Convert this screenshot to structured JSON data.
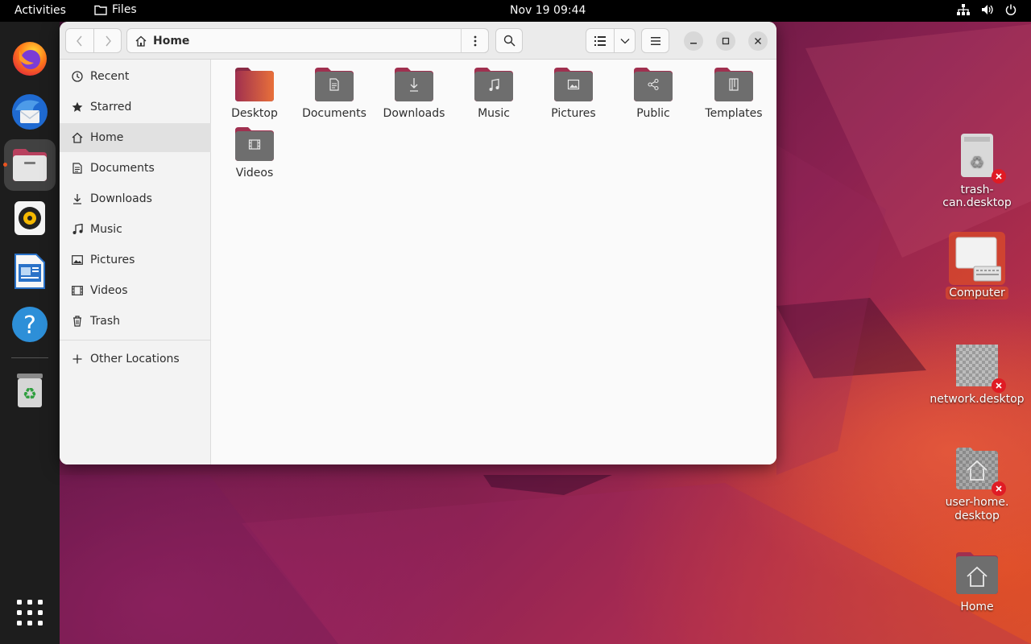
{
  "topbar": {
    "activities": "Activities",
    "app_name": "Files",
    "clock": "Nov 19  09:44"
  },
  "dock": {
    "apps": [
      "firefox",
      "thunderbird",
      "files",
      "rhythmbox",
      "libreoffice-writer",
      "help",
      "trash"
    ]
  },
  "window": {
    "path": "Home",
    "sidebar": [
      {
        "label": "Recent",
        "icon": "clock-icon"
      },
      {
        "label": "Starred",
        "icon": "star-icon"
      },
      {
        "label": "Home",
        "icon": "home-icon"
      },
      {
        "label": "Documents",
        "icon": "document-icon"
      },
      {
        "label": "Downloads",
        "icon": "download-icon"
      },
      {
        "label": "Music",
        "icon": "music-icon"
      },
      {
        "label": "Pictures",
        "icon": "picture-icon"
      },
      {
        "label": "Videos",
        "icon": "video-icon"
      },
      {
        "label": "Trash",
        "icon": "trash-icon"
      }
    ],
    "other_locations": "Other Locations",
    "folders": [
      {
        "label": "Desktop"
      },
      {
        "label": "Documents"
      },
      {
        "label": "Downloads"
      },
      {
        "label": "Music"
      },
      {
        "label": "Pictures"
      },
      {
        "label": "Public"
      },
      {
        "label": "Templates"
      },
      {
        "label": "Videos"
      }
    ]
  },
  "desktop": {
    "icons": [
      {
        "label": "trash-can.desktop"
      },
      {
        "label": "Computer"
      },
      {
        "label": "network.desktop"
      },
      {
        "label": "user-home.\ndesktop"
      },
      {
        "label": "Home"
      }
    ]
  },
  "colors": {
    "accent": "#e95420",
    "folder": "#6e6e6e",
    "folder_tab": "#a0304f"
  }
}
